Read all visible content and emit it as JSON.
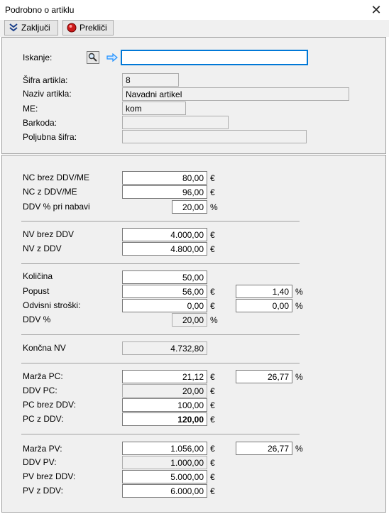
{
  "window": {
    "title": "Podrobno o artiklu"
  },
  "toolbar": {
    "confirm_label": "Zaključi",
    "cancel_label": "Prekliči"
  },
  "search": {
    "label": "Iskanje:",
    "value": ""
  },
  "article": {
    "code_label": "Šifra artikla:",
    "code": "8",
    "name_label": "Naziv artikla:",
    "name": "Navadni artikel",
    "unit_label": "ME:",
    "unit": "kom",
    "barcode_label": "Barkoda:",
    "barcode": "",
    "custom_code_label": "Poljubna šifra:",
    "custom_code": ""
  },
  "purchase": {
    "nc_net_label": "NC brez DDV/ME",
    "nc_net": "80,00",
    "nc_gross_label": "NC z DDV/ME",
    "nc_gross": "96,00",
    "vat_label": "DDV % pri nabavi",
    "vat": "20,00"
  },
  "purchase_value": {
    "net_label": "NV brez DDV",
    "net": "4.000,00",
    "gross_label": "NV z DDV",
    "gross": "4.800,00"
  },
  "quantity": {
    "qty_label": "Količina",
    "qty": "50,00",
    "discount_label": "Popust",
    "discount": "56,00",
    "discount_pct": "1,40",
    "costs_label": "Odvisni stroški:",
    "costs": "0,00",
    "costs_pct": "0,00",
    "vat_label": "DDV %",
    "vat": "20,00"
  },
  "final": {
    "label": "Končna NV",
    "value": "4.732,80"
  },
  "retail": {
    "margin_label": "Marža PC:",
    "margin": "21,12",
    "margin_pct": "26,77",
    "vat_label": "DDV PC:",
    "vat": "20,00",
    "net_label": "PC brez DDV:",
    "net": "100,00",
    "gross_label": "PC z DDV:",
    "gross": "120,00"
  },
  "sales": {
    "margin_label": "Marža PV:",
    "margin": "1.056,00",
    "margin_pct": "26,77",
    "vat_label": "DDV PV:",
    "vat": "1.000,00",
    "net_label": "PV brez DDV:",
    "net": "5.000,00",
    "gross_label": "PV z DDV:",
    "gross": "6.000,00"
  },
  "units": {
    "euro": "€",
    "percent": "%"
  },
  "colors": {
    "accent_blue": "#1e90ff",
    "stop_red": "#cc1a1a",
    "focus_border": "#0078d7"
  }
}
